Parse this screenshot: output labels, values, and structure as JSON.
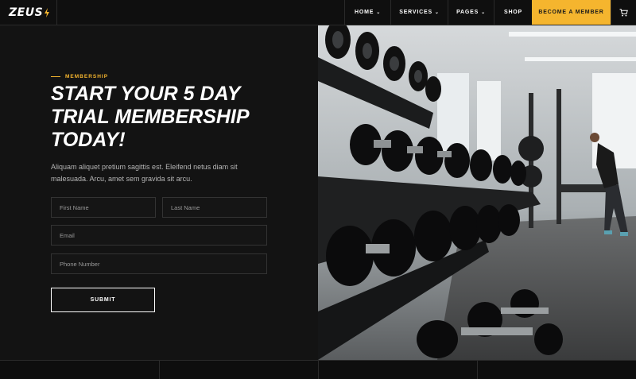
{
  "brand": {
    "name": "ZEUS",
    "accent": "#f5b52e"
  },
  "nav": {
    "items": [
      {
        "label": "HOME",
        "caret": "⌄"
      },
      {
        "label": "SERVICES",
        "caret": "⌄"
      },
      {
        "label": "PAGES",
        "caret": "⌄"
      },
      {
        "label": "SHOP"
      }
    ],
    "cta": "BECOME A MEMBER",
    "cart_icon": "cart-icon"
  },
  "hero": {
    "eyebrow": "MEMBERSHIP",
    "title": "START YOUR 5 DAY TRIAL MEMBERSHIP TODAY!",
    "description": "Aliquam aliquet pretium sagittis est. Eleifend netus diam sit malesuada. Arcu, amet sem gravida sit arcu."
  },
  "form": {
    "first_name": "First Name",
    "last_name": "Last Name",
    "email": "Email",
    "phone": "Phone Number",
    "submit": "SUBMIT"
  },
  "photo": {
    "subject": "gym-dumbbell-rack-image"
  }
}
